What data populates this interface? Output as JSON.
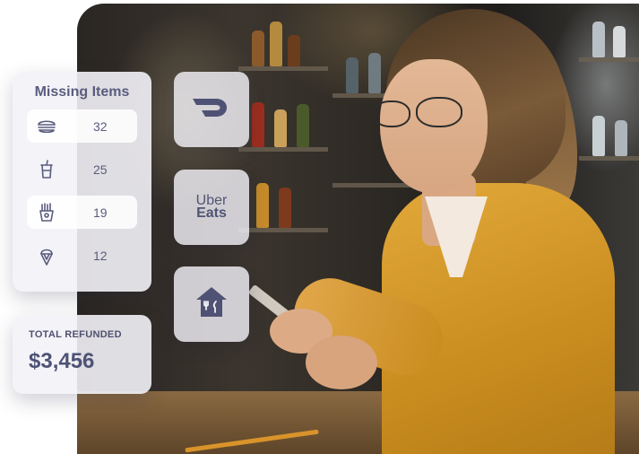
{
  "missing_items": {
    "title": "Missing Items",
    "rows": [
      {
        "icon": "burger-icon",
        "count": "32"
      },
      {
        "icon": "drink-cup-icon",
        "count": "25"
      },
      {
        "icon": "fries-icon",
        "count": "19"
      },
      {
        "icon": "ice-cream-icon",
        "count": "12"
      }
    ]
  },
  "total_refunded": {
    "label": "TOTAL REFUNDED",
    "value": "$3,456"
  },
  "delivery_apps": [
    {
      "icon": "doordash-logo-icon"
    },
    {
      "icon": "ubereats-logo-icon",
      "line1": "Uber",
      "line2": "Eats"
    },
    {
      "icon": "grubhub-logo-icon"
    }
  ],
  "colors": {
    "card_text": "#5a5c7e",
    "card_bg": "#f3f2f7",
    "shirt": "#d9a02c"
  }
}
